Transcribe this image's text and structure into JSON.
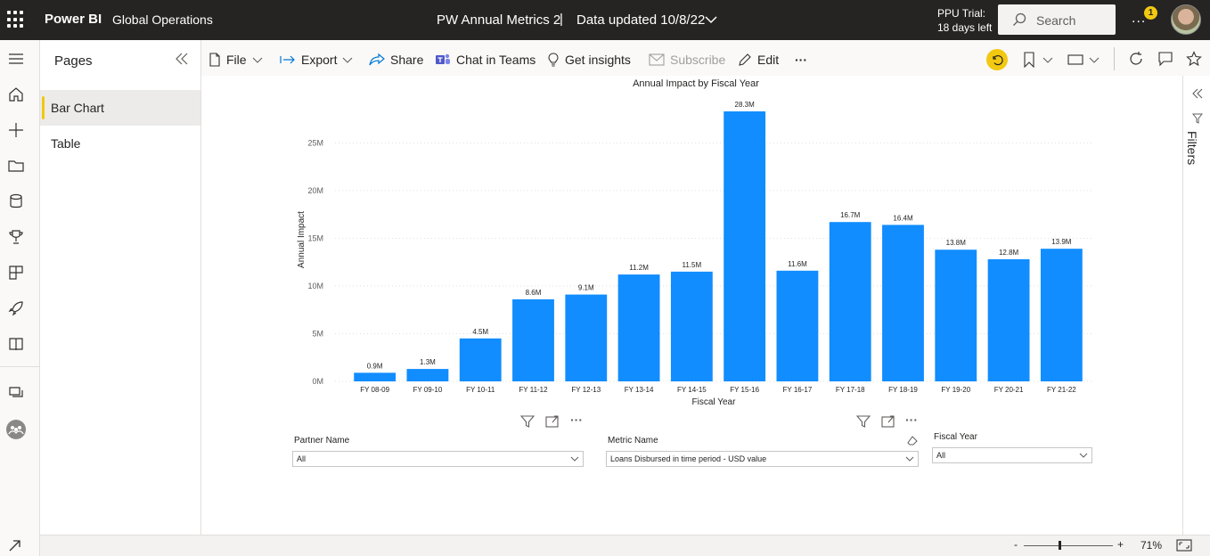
{
  "header": {
    "brand": "Power BI",
    "workspace": "Global Operations",
    "report_title": "PW Annual Metrics 2",
    "separator": "|",
    "updated": "Data updated 10/8/22",
    "trial_line1": "PPU Trial:",
    "trial_line2": "18 days left",
    "search_placeholder": "Search",
    "more_label": "...",
    "notification_count": "1"
  },
  "pages_pane": {
    "title": "Pages",
    "items": [
      {
        "label": "Bar Chart",
        "active": true
      },
      {
        "label": "Table",
        "active": false
      }
    ]
  },
  "toolbar": {
    "file": "File",
    "export": "Export",
    "share": "Share",
    "chat": "Chat in Teams",
    "insights": "Get insights",
    "subscribe": "Subscribe",
    "edit": "Edit",
    "more": "···"
  },
  "filters_pane": {
    "label": "Filters"
  },
  "chart_data": {
    "type": "bar",
    "title": "Annual Impact by Fiscal Year",
    "xlabel": "Fiscal Year",
    "ylabel": "Annual Impact",
    "ylim": [
      0,
      28300000
    ],
    "yticks": [
      {
        "value": 0,
        "label": "0M"
      },
      {
        "value": 5000000,
        "label": "5M"
      },
      {
        "value": 10000000,
        "label": "10M"
      },
      {
        "value": 15000000,
        "label": "15M"
      },
      {
        "value": 20000000,
        "label": "20M"
      },
      {
        "value": 25000000,
        "label": "25M"
      }
    ],
    "categories": [
      "FY 08-09",
      "FY 09-10",
      "FY 10-11",
      "FY 11-12",
      "FY 12-13",
      "FY 13-14",
      "FY 14-15",
      "FY 15-16",
      "FY 16-17",
      "FY 17-18",
      "FY 18-19",
      "FY 19-20",
      "FY 20-21",
      "FY 21-22"
    ],
    "values": [
      900000,
      1300000,
      4500000,
      8600000,
      9100000,
      11200000,
      11500000,
      28300000,
      11600000,
      16700000,
      16400000,
      13800000,
      12800000,
      13900000
    ],
    "data_labels": [
      "0.9M",
      "1.3M",
      "4.5M",
      "8.6M",
      "9.1M",
      "11.2M",
      "11.5M",
      "28.3M",
      "11.6M",
      "16.7M",
      "16.4M",
      "13.8M",
      "12.8M",
      "13.9M"
    ],
    "bar_color": "#118dff",
    "grid": true,
    "legend": "none"
  },
  "slicers": {
    "partner": {
      "label": "Partner Name",
      "value": "All"
    },
    "metric": {
      "label": "Metric Name",
      "value": "Loans Disbursed in time period - USD value"
    },
    "fiscal_year": {
      "label": "Fiscal Year",
      "value": "All"
    }
  },
  "status_bar": {
    "zoom_minus": "-",
    "zoom_plus": "+",
    "zoom_level": "71%",
    "zoom_fraction": 0.4
  }
}
